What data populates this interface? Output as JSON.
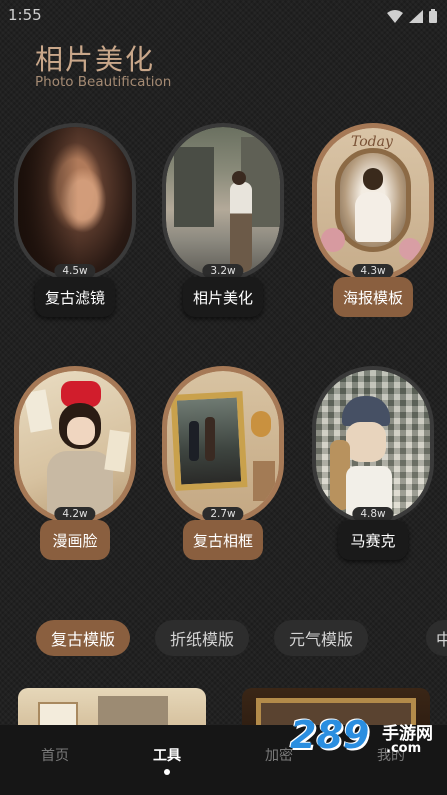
{
  "status_bar": {
    "time": "1:55"
  },
  "header": {
    "title": "相片美化",
    "subtitle": "Photo Beautification"
  },
  "features": [
    {
      "label": "复古滤镜",
      "count": "4.5w"
    },
    {
      "label": "相片美化",
      "count": "3.2w"
    },
    {
      "label": "海报模板",
      "count": "4.3w"
    },
    {
      "label": "漫画脸",
      "count": "4.2w"
    },
    {
      "label": "复古相框",
      "count": "2.7w"
    },
    {
      "label": "马赛克",
      "count": "4.8w"
    }
  ],
  "poster_art_text": "Today",
  "template_tabs": [
    {
      "label": "复古模版"
    },
    {
      "label": "折纸模版"
    },
    {
      "label": "元气模版"
    },
    {
      "label": "中"
    }
  ],
  "bottom_nav": [
    {
      "label": "首页"
    },
    {
      "label": "工具"
    },
    {
      "label": "加密"
    },
    {
      "label": "我的"
    }
  ],
  "watermark": {
    "number": "289",
    "suffix": "手游网",
    "url": ".com"
  },
  "colors": {
    "accent": "#8a5f3f",
    "title": "#c9a78a",
    "background": "#1e1e1e"
  }
}
